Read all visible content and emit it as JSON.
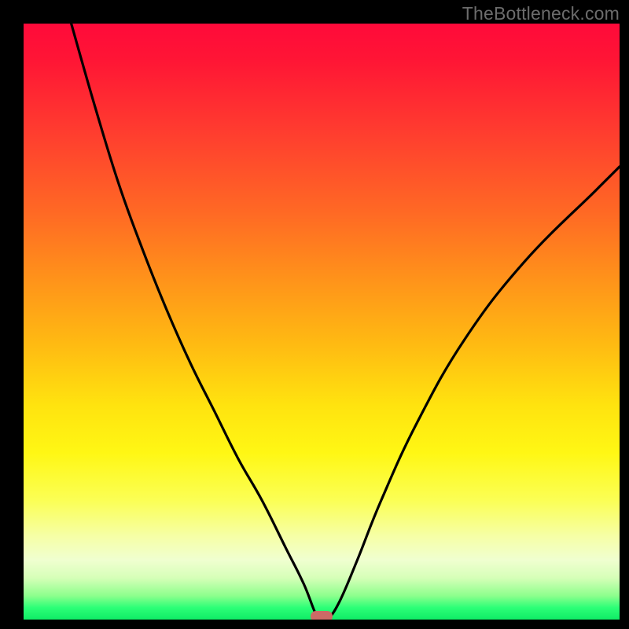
{
  "watermark": "TheBottleneck.com",
  "colors": {
    "frame": "#000000",
    "curve": "#000000",
    "marker": "#cc6a66",
    "gradient_top": "#ff0a3a",
    "gradient_mid": "#ffe30f",
    "gradient_bottom": "#10ec66",
    "watermark_text": "#6c6c6c"
  },
  "chart_data": {
    "type": "line",
    "title": "",
    "xlabel": "",
    "ylabel": "",
    "xlim": [
      0,
      100
    ],
    "ylim": [
      0,
      100
    ],
    "notes": "V-shaped bottleneck curve. Minimum near x≈50. Background encodes bottleneck % as heat gradient (top=100%=red, bottom=0%=green). Marker at the valley.",
    "series": [
      {
        "name": "bottleneck-curve",
        "x": [
          8,
          12,
          16,
          20,
          24,
          28,
          32,
          36,
          40,
          44,
          47,
          49,
          50,
          51,
          53,
          56,
          60,
          66,
          74,
          84,
          96,
          100
        ],
        "values": [
          100,
          86,
          73,
          62,
          52,
          43,
          35,
          27,
          20,
          12,
          6,
          1,
          0,
          0,
          3,
          10,
          20,
          33,
          47,
          60,
          72,
          76
        ]
      }
    ],
    "marker": {
      "x": 50,
      "y": 0
    }
  }
}
